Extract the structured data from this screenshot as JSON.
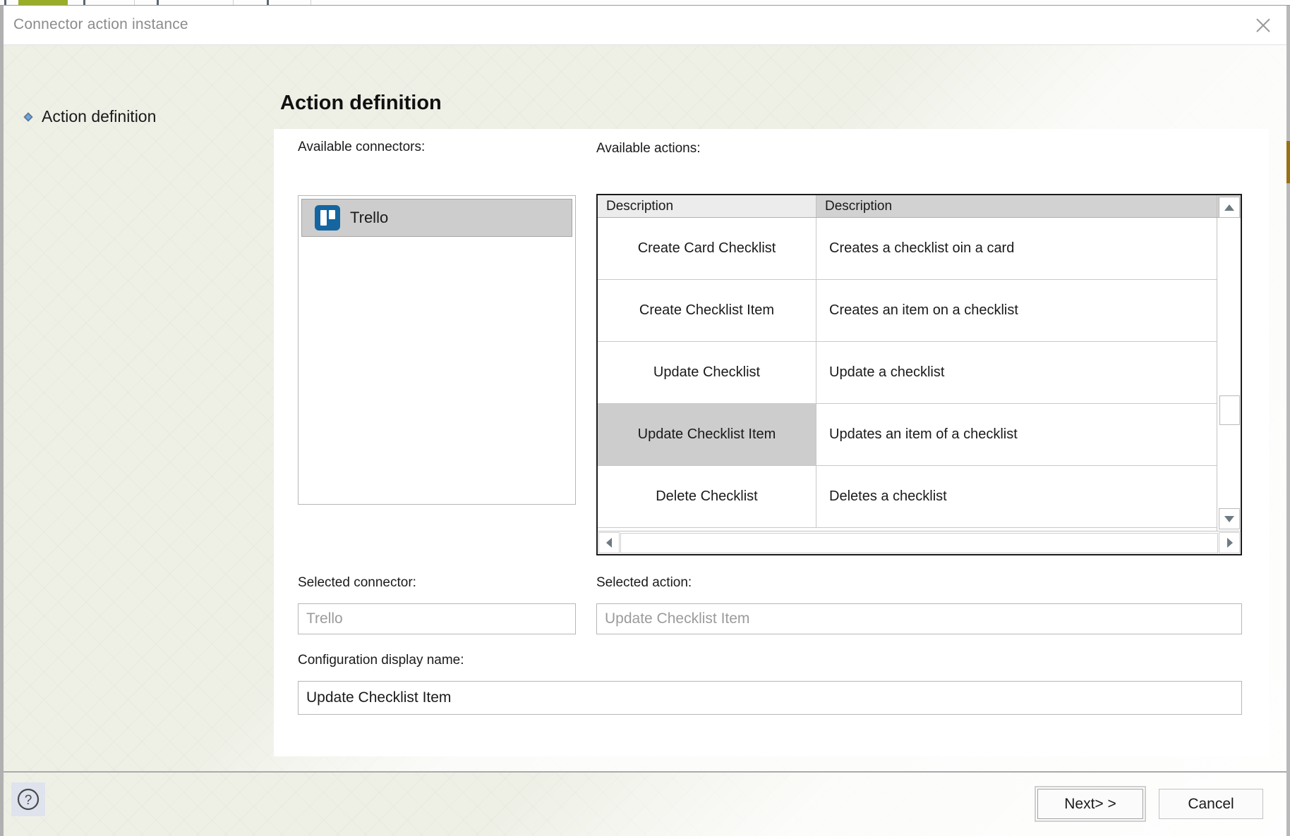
{
  "window": {
    "title": "Connector action instance",
    "close_icon": "close-icon"
  },
  "sidebar": {
    "items": [
      {
        "label": "Action definition",
        "bullet_icon": "diamond-bullet-icon"
      }
    ]
  },
  "page": {
    "heading": "Action definition"
  },
  "connectors": {
    "label": "Available connectors:",
    "items": [
      {
        "name": "Trello",
        "icon": "trello-icon",
        "selected": true
      }
    ]
  },
  "actions": {
    "label": "Available actions:",
    "columns": [
      "Description",
      "Description"
    ],
    "rows": [
      {
        "name": "Create Card Checklist",
        "description": "Creates a checklist oin a card",
        "selected": false
      },
      {
        "name": "Create Checklist Item",
        "description": "Creates an item on a checklist",
        "selected": false
      },
      {
        "name": "Update Checklist",
        "description": "Update a checklist",
        "selected": false
      },
      {
        "name": "Update Checklist Item",
        "description": "Updates an item of a checklist",
        "selected": true
      },
      {
        "name": "Delete Checklist",
        "description": "Deletes a checklist",
        "selected": false
      }
    ]
  },
  "selected_connector": {
    "label": "Selected connector:",
    "value": "Trello"
  },
  "selected_action": {
    "label": "Selected action:",
    "value": "Update Checklist Item"
  },
  "configuration_display_name": {
    "label": "Configuration display name:",
    "value": "Update Checklist Item"
  },
  "footer": {
    "help_label": "?",
    "next_label": "Next> >",
    "cancel_label": "Cancel"
  },
  "colors": {
    "selection": "#cdcdcd",
    "trello_blue": "#1565a0",
    "body_bg": "#eef0e6",
    "accent_gold": "#9a7014",
    "accent_green": "#9aad28"
  }
}
